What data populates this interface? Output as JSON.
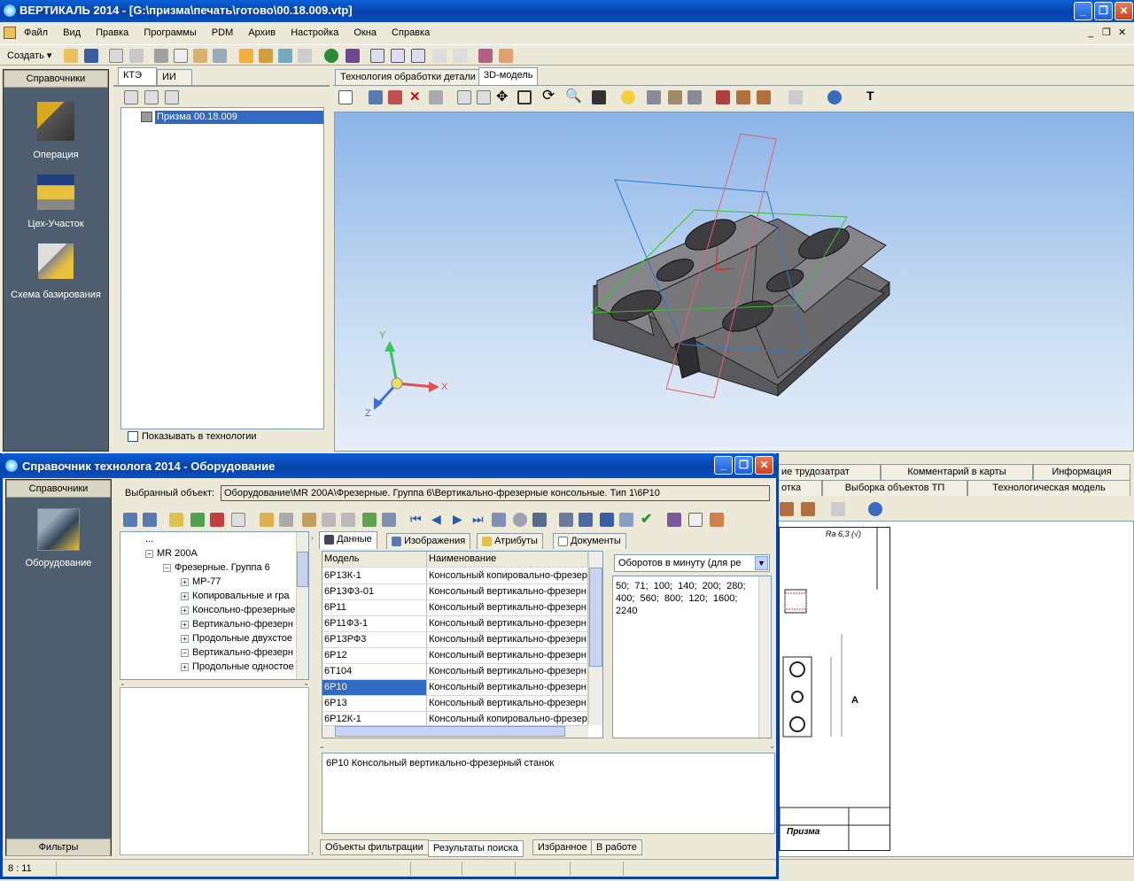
{
  "app": {
    "title": "ВЕРТИКАЛЬ 2014 - [G:\\призма\\печать\\готово\\00.18.009.vtp]",
    "menu": [
      "Файл",
      "Вид",
      "Правка",
      "Программы",
      "PDM",
      "Архив",
      "Настройка",
      "Окна",
      "Справка"
    ],
    "create_label": "Создать",
    "left_panel": {
      "header": "Справочники",
      "items": [
        {
          "label": "Операция",
          "icon": "anvil-operation-icon"
        },
        {
          "label": "Цех-Участок",
          "icon": "workshop-number-icon"
        },
        {
          "label": "Схема базирования",
          "icon": "basing-scheme-icon"
        }
      ]
    },
    "tree_tabs": [
      "КТЭ",
      "ИИ"
    ],
    "tree_root": "Призма 00.18.009",
    "show_in_tech": "Показывать в технологии",
    "doc_tabs": [
      "Технология обработки детали",
      "3D-модель"
    ],
    "axes": {
      "x": "X",
      "y": "Y",
      "z": "Z"
    },
    "right_tabs_row1": [
      "ие трудозатрат",
      "Комментарий в карты",
      "Информация"
    ],
    "right_tabs_row2": [
      "отка",
      "Выборка объектов ТП",
      "Технологическая модель"
    ],
    "drawing": {
      "roughness": "Ra 6,3 (√)",
      "part_name": "Призма",
      "label_a": "А"
    }
  },
  "dialog": {
    "title": "Справочник технолога 2014 - Оборудование",
    "left_header": "Справочники",
    "left_item": "Оборудование",
    "left_footer": "Фильтры",
    "selected_label": "Выбранный объект:",
    "selected_value": "Оборудование\\MR 200A\\Фрезерные. Группа 6\\Вертикально-фрезерные консольные. Тип 1\\6Р10",
    "tree": [
      {
        "label": "...",
        "level": 1,
        "expander": ""
      },
      {
        "label": "MR 200A",
        "level": 1,
        "expander": "−"
      },
      {
        "label": "Фрезерные. Группа 6",
        "level": 2,
        "expander": "−"
      },
      {
        "label": "МР-77",
        "level": 3,
        "expander": "+"
      },
      {
        "label": "Копировальные и гра",
        "level": 3,
        "expander": "+"
      },
      {
        "label": "Консольно-фрезерные",
        "level": 3,
        "expander": "+"
      },
      {
        "label": "Вертикально-фрезерн",
        "level": 3,
        "expander": "+"
      },
      {
        "label": "Продольные двухстое",
        "level": 3,
        "expander": "+"
      },
      {
        "label": "Вертикально-фрезерн",
        "level": 3,
        "expander": "−"
      },
      {
        "label": "Продольные одностое",
        "level": 3,
        "expander": "+"
      }
    ],
    "data_tabs": [
      "Данные",
      "Изображения",
      "Атрибуты",
      "Документы"
    ],
    "columns": [
      "Модель",
      "Наименование"
    ],
    "rows": [
      [
        "6Р13К-1",
        "Консольный копировально-фрезерн"
      ],
      [
        "6Р13Ф3-01",
        "Консольный вертикально-фрезерн"
      ],
      [
        "6Р11",
        "Консольный вертикально-фрезерн"
      ],
      [
        "6Р11Ф3-1",
        "Консольный вертикально-фрезерн"
      ],
      [
        "6Р13РФ3",
        "Консольный вертикально-фрезерн"
      ],
      [
        "6Р12",
        "Консольный вертикально-фрезерн"
      ],
      [
        "6Т104",
        "Консольный вертикально-фрезерн"
      ],
      [
        "6Р10",
        "Консольный вертикально-фрезерн"
      ],
      [
        "6Р13",
        "Консольный вертикально-фрезерн"
      ],
      [
        "6Р12К-1",
        "Консольный копировально-фрезерн"
      ]
    ],
    "selected_row": 7,
    "param_select": "Оборотов в минуту (для ре",
    "param_value": "50; 71; 100; 140; 200; 280; 400; 560; 800; 120; 1600; 2240",
    "description": "6Р10 Консольный вертикально-фрезерный станок",
    "bottom_tabs": [
      "Объекты фильтрации",
      "Результаты поиска",
      "Избранное",
      "В работе"
    ],
    "status": "8 : 11"
  },
  "colors": {
    "accent": "#316ac5",
    "panel": "#4e5e6e",
    "xp_blue": "#0842a8"
  }
}
